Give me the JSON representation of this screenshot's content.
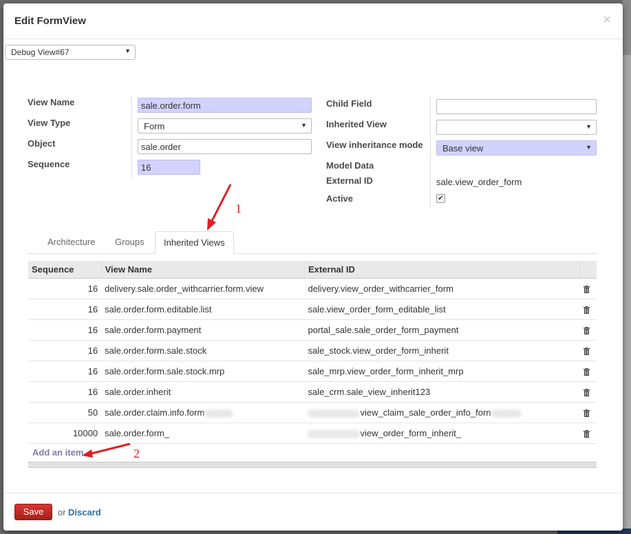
{
  "dialog": {
    "title": "Edit FormView",
    "close_symbol": "×"
  },
  "debug": {
    "selected": "Debug View#67"
  },
  "form": {
    "left": [
      {
        "label": "View Name",
        "value": "sale.order.form"
      },
      {
        "label": "View Type",
        "value": "Form"
      },
      {
        "label": "Object",
        "value": "sale.order"
      },
      {
        "label": "Sequence",
        "value": "16"
      }
    ],
    "right": {
      "child_field": {
        "label": "Child Field",
        "value": ""
      },
      "inherited_view": {
        "label": "Inherited View",
        "value": ""
      },
      "inheritance_mode": {
        "label": "View inheritance mode",
        "value": "Base view"
      },
      "model_data": {
        "label": "Model Data"
      },
      "external_id": {
        "label": "External ID",
        "value": "sale.view_order_form"
      },
      "active": {
        "label": "Active",
        "checked": true
      }
    }
  },
  "tabs": [
    "Architecture",
    "Groups",
    "Inherited Views"
  ],
  "grid": {
    "headers": [
      "Sequence",
      "View Name",
      "External ID"
    ],
    "rows": [
      {
        "seq": "16",
        "name": "delivery.sale.order_withcarrier.form.view",
        "xid": "delivery.view_order_withcarrier_form"
      },
      {
        "seq": "16",
        "name": "sale.order.form.editable.list",
        "xid": "sale.view_order_form_editable_list"
      },
      {
        "seq": "16",
        "name": "sale.order.form.payment",
        "xid": "portal_sale.sale_order_form_payment"
      },
      {
        "seq": "16",
        "name": "sale.order.form.sale.stock",
        "xid": "sale_stock.view_order_form_inherit"
      },
      {
        "seq": "16",
        "name": "sale.order.form.sale.stock.mrp",
        "xid": "sale_mrp.view_order_form_inherit_mrp"
      },
      {
        "seq": "16",
        "name": "sale.order.inherit",
        "xid": "sale_crm.sale_view_inherit123"
      },
      {
        "seq": "50",
        "name": "sale.order.claim.info.form",
        "xid": "view_claim_sale_order_info_forn"
      },
      {
        "seq": "10000",
        "name": "sale.order.form_",
        "xid": "view_order_form_inherit_"
      }
    ],
    "add_item": "Add an item"
  },
  "footer": {
    "save": "Save",
    "or": "or",
    "discard": "Discard"
  },
  "annotations": {
    "a1": "1",
    "a2": "2"
  },
  "colors": {
    "required_bg": "#d2d2ff",
    "save": "#c22a24",
    "link": "#2a6ea6",
    "annot": "#e02020"
  }
}
